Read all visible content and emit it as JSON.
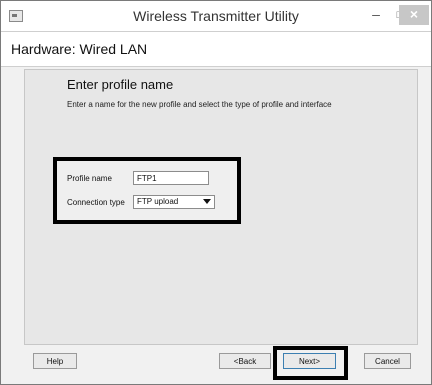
{
  "window": {
    "title": "Wireless Transmitter Utility",
    "minimize": "–",
    "maximize": "□",
    "close": "×"
  },
  "header": {
    "title": "Hardware: Wired LAN"
  },
  "content": {
    "heading": "Enter profile name",
    "description": "Enter a name for the new profile and select the type of profile and interface"
  },
  "form": {
    "profile_name_label": "Profile name",
    "profile_name_value": "FTP1",
    "connection_type_label": "Connection type",
    "connection_type_value": "FTP upload"
  },
  "buttons": {
    "help": "Help",
    "back": "<Back",
    "next": "Next>",
    "cancel": "Cancel"
  }
}
